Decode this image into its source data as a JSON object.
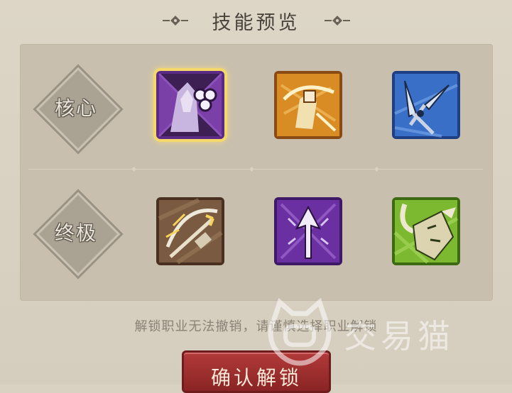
{
  "header": {
    "title": "技能预览"
  },
  "rows": [
    {
      "category": "核心",
      "skills": [
        {
          "icon": "hooded-caster-icon",
          "frame_color": "#7b3fa8",
          "selected": true
        },
        {
          "icon": "golden-archer-icon",
          "frame_color": "#c9731c",
          "selected": false
        },
        {
          "icon": "spear-tips-icon",
          "frame_color": "#2f5fb8",
          "selected": false
        }
      ]
    },
    {
      "category": "终极",
      "skills": [
        {
          "icon": "crossbow-icon",
          "frame_color": "#6b4a35",
          "selected": false
        },
        {
          "icon": "arrow-burst-icon",
          "frame_color": "#6a2fa0",
          "selected": false
        },
        {
          "icon": "horned-hunter-icon",
          "frame_color": "#5c9a1f",
          "selected": false
        }
      ]
    }
  ],
  "note": "解锁职业无法撤销，请谨慎选择职业解锁",
  "confirm_button": {
    "label": "确认解锁"
  },
  "watermark": {
    "text": "交易猫"
  },
  "colors": {
    "accent": "#f5d86a",
    "button": "#a83232",
    "panel": "#d9d2c2"
  }
}
